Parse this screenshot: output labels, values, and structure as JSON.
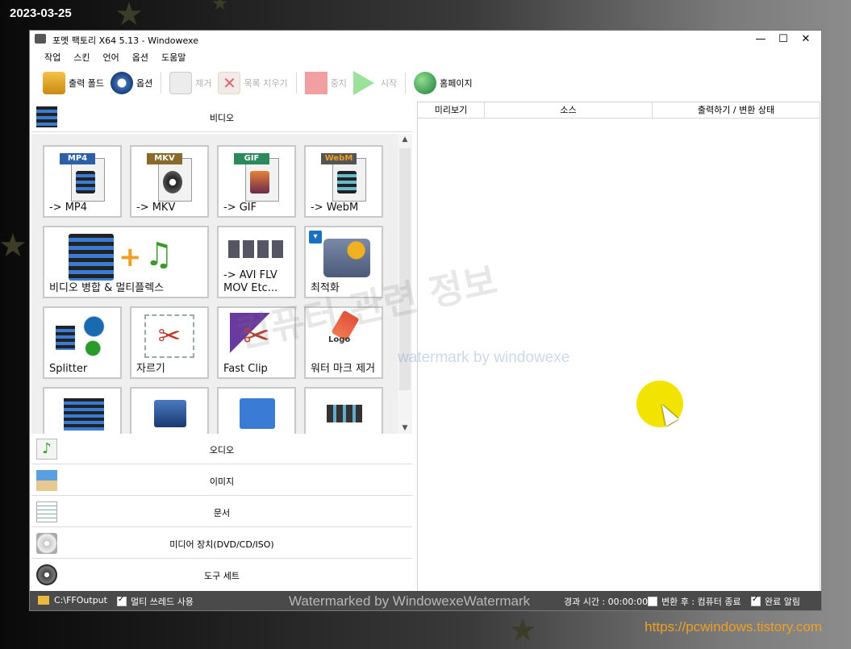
{
  "overlay": {
    "date": "2023-03-25",
    "site_url": "https://pcwindows.tistory.com",
    "watermark_big": "컴퓨터 관련 정보",
    "watermark_small": "watermark by windowexe",
    "watermark_bottom": "Watermarked by WindowexeWatermark"
  },
  "window": {
    "title": "포멧 팩토리 X64 5.13   - Windowexe",
    "minimize": "—",
    "maximize": "☐",
    "close": "✕"
  },
  "menu": [
    "작업",
    "스킨",
    "언어",
    "옵션",
    "도움말"
  ],
  "toolbar": {
    "output_folder": "출력 폴드",
    "options": "옵션",
    "remove": "제거",
    "clear_list": "목록 지우기",
    "stop": "중지",
    "start": "시작",
    "homepage": "홈페이지"
  },
  "categories": {
    "video": "비디오",
    "audio": "오디오",
    "image": "이미지",
    "document": "문서",
    "media_device": "미디어 장치(DVD/CD/ISO)",
    "tools": "도구 세트"
  },
  "tiles": {
    "mp4": {
      "label": "-> MP4",
      "tag": "MP4"
    },
    "mkv": {
      "label": "-> MKV",
      "tag": "MKV"
    },
    "gif": {
      "label": "-> GIF",
      "tag": "GIF"
    },
    "webm": {
      "label": "-> WebM",
      "tag": "WebM"
    },
    "merge": {
      "label": "비디오 병합 & 멀티플렉스"
    },
    "avi": {
      "label": "-> AVI FLV MOV Etc..."
    },
    "optimize": {
      "label": "최적화"
    },
    "splitter": {
      "label": "Splitter"
    },
    "crop": {
      "label": "자르기"
    },
    "fastclip": {
      "label": "Fast Clip"
    },
    "watermark_remove": {
      "label": "워터 마크 제거",
      "logo": "Logo"
    }
  },
  "task_columns": [
    "미리보기",
    "소스",
    "출력하기 / 변환 상태"
  ],
  "status": {
    "output_path": "C:\\FFOutput",
    "multithread": "멀티 쓰레드 사용",
    "elapsed": "경과 시간 : 00:00:00",
    "after_convert": "변환 후 : 컴퓨터 종료",
    "notify": "완료 알림"
  }
}
